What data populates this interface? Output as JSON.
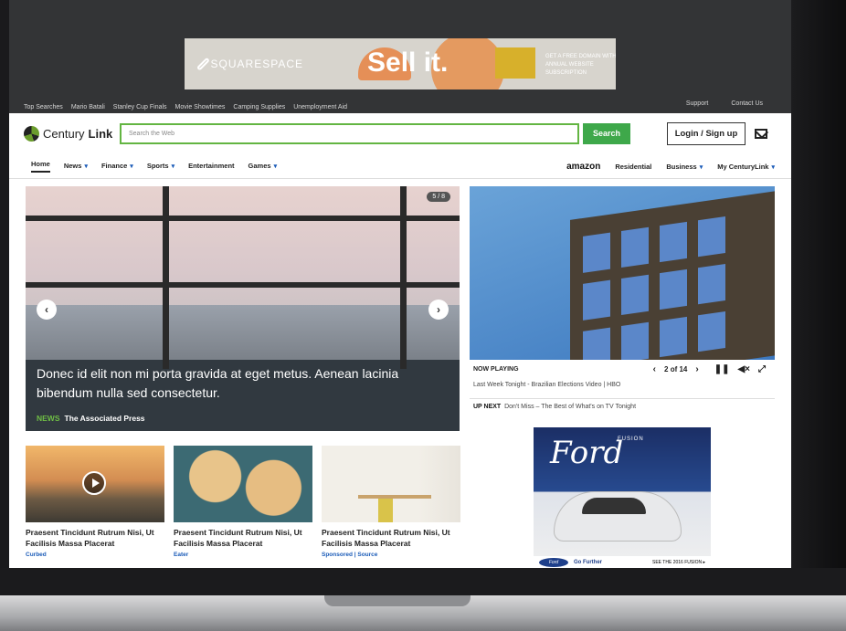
{
  "ad_banner": {
    "brand": "SQUARESPACE",
    "headline": "Sell it.",
    "offer": "GET A FREE DOMAIN WITH ANNUAL WEBSITE SUBSCRIPTION"
  },
  "top_searches": {
    "items": [
      "Top Searches",
      "Mario Batali",
      "Stanley Cup Finals",
      "Movie Showtimes",
      "Camping Supplies",
      "Unemployment Aid"
    ],
    "right_links": [
      "Support",
      "Contact Us"
    ]
  },
  "header": {
    "logo_prefix": "Century",
    "logo_bold": "Link",
    "search_placeholder": "Search the Web",
    "search_button": "Search",
    "login_button": "Login / Sign up"
  },
  "nav": {
    "left": [
      {
        "label": "Home",
        "caret": false
      },
      {
        "label": "News",
        "caret": true
      },
      {
        "label": "Finance",
        "caret": true
      },
      {
        "label": "Sports",
        "caret": true
      },
      {
        "label": "Entertainment",
        "caret": false
      },
      {
        "label": "Games",
        "caret": true
      }
    ],
    "amazon": "amazon",
    "right": [
      {
        "label": "Residential",
        "caret": false
      },
      {
        "label": "Business",
        "caret": true
      },
      {
        "label": "My CenturyLink",
        "caret": true
      }
    ]
  },
  "hero": {
    "counter": "5 / 8",
    "caption": "Donec id elit non mi porta gravida at eget metus. Aenean lacinia bibendum nulla sed consectetur.",
    "category": "NEWS",
    "source": "The Associated Press"
  },
  "video": {
    "now_playing": "NOW PLAYING",
    "position": "2 of 14",
    "title": "Last Week Tonight - Brazilian Elections Video | HBO",
    "up_next_label": "UP NEXT",
    "up_next": "Don't Miss – The Best of What's on TV Tonight"
  },
  "ford_ad": {
    "script": "Ford",
    "model": "FUSION",
    "tagline": "Go Further",
    "cta": "SEE THE 2016 FUSION ▸"
  },
  "cards": [
    {
      "title": "Praesent Tincidunt Rutrum Nisi, Ut Facilisis Massa Placerat",
      "source": "Curbed"
    },
    {
      "title": "Praesent Tincidunt Rutrum Nisi, Ut Facilisis Massa Placerat",
      "source": "Eater"
    },
    {
      "title": "Praesent Tincidunt Rutrum Nisi, Ut Facilisis Massa Placerat",
      "source": "Sponsored | Source"
    }
  ],
  "colors": {
    "accent_green": "#3ea84a",
    "link_blue": "#1a5bb8",
    "news_green": "#6fbe45"
  }
}
